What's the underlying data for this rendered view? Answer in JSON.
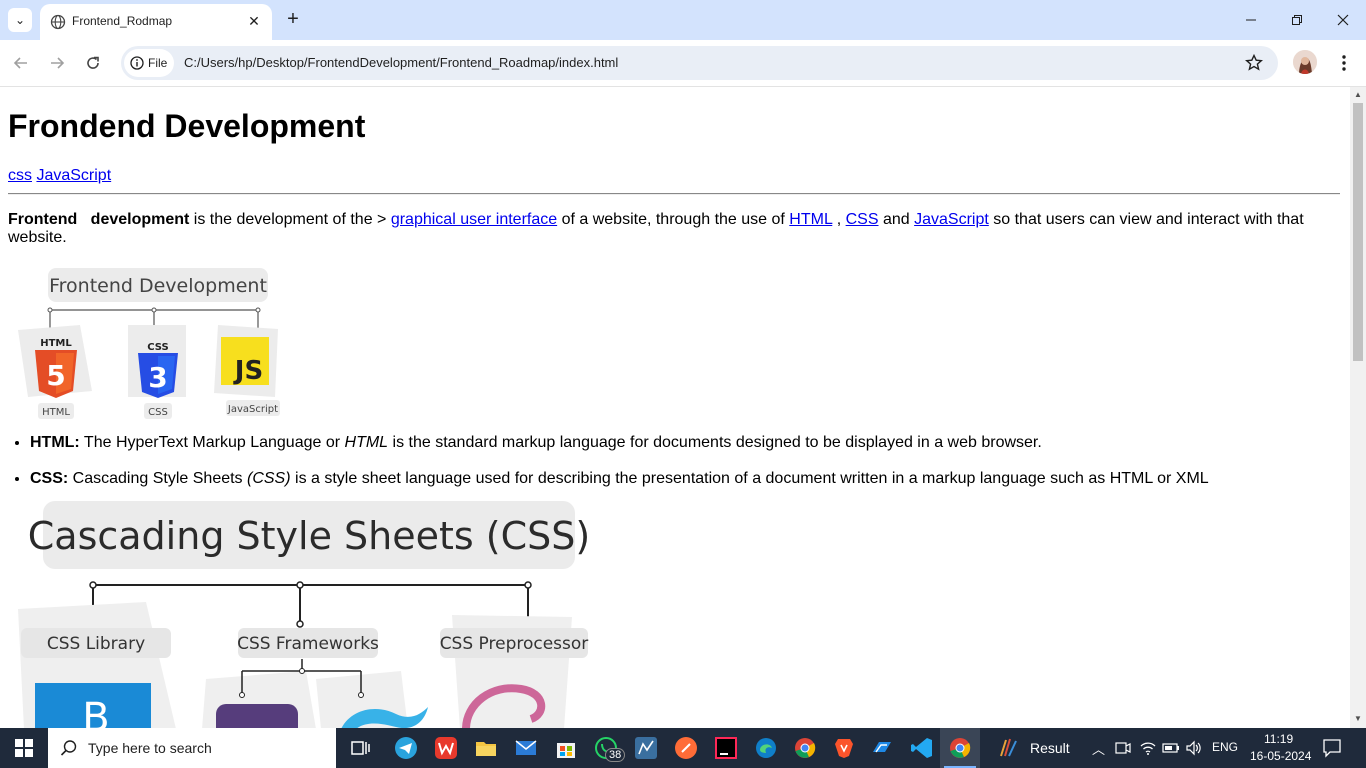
{
  "browser": {
    "tab_title": "Frontend_Rodmap",
    "url_chip": "File",
    "url": "C:/Users/hp/Desktop/FrontendDevelopment/Frontend_Roadmap/index.html",
    "colors": {
      "tabbar": "#d3e3fd",
      "omnibox": "#e9eef6"
    }
  },
  "page": {
    "title": "Frondend Development",
    "nav": [
      "css",
      "JavaScript"
    ],
    "intro": {
      "bold1": "Frontend",
      "bold2": "development",
      "text1": " is the development of the > ",
      "link1": "graphical user interface",
      "text2": " of a website, through the use of ",
      "link2": "HTML",
      "text3": " , ",
      "link3": "CSS",
      "text4": " and ",
      "link4": "JavaScript",
      "text5": " so that users can view and interact with that website."
    },
    "fd_diagram": {
      "title": "Frontend Development",
      "items": [
        "HTML",
        "CSS",
        "JavaScript"
      ],
      "logo_html": "HTML",
      "logo_css": "CSS",
      "logo_js": "JS",
      "logo_html_num": "5",
      "logo_css_num": "3"
    },
    "list": [
      {
        "term": "HTML:",
        "text1": " The HyperText Markup Language or ",
        "em": "HTML",
        "text2": " is the standard markup language for documents designed to be displayed in a web browser."
      },
      {
        "term": "CSS:",
        "text1": " Cascading Style Sheets ",
        "em": "(CSS)",
        "text2": " is a style sheet language used for describing the presentation of a document written in a markup language such as HTML or XML"
      }
    ],
    "css_diagram": {
      "title": "Cascading Style Sheets (CSS)",
      "items": [
        "CSS Library",
        "CSS Frameworks",
        "CSS Preprocessor"
      ],
      "logo_b": "B"
    }
  },
  "taskbar": {
    "search_placeholder": "Type here to search",
    "whatsapp_badge": "38",
    "result_label": "Result",
    "lang": "ENG",
    "time": "11:19",
    "date": "16-05-2024"
  }
}
